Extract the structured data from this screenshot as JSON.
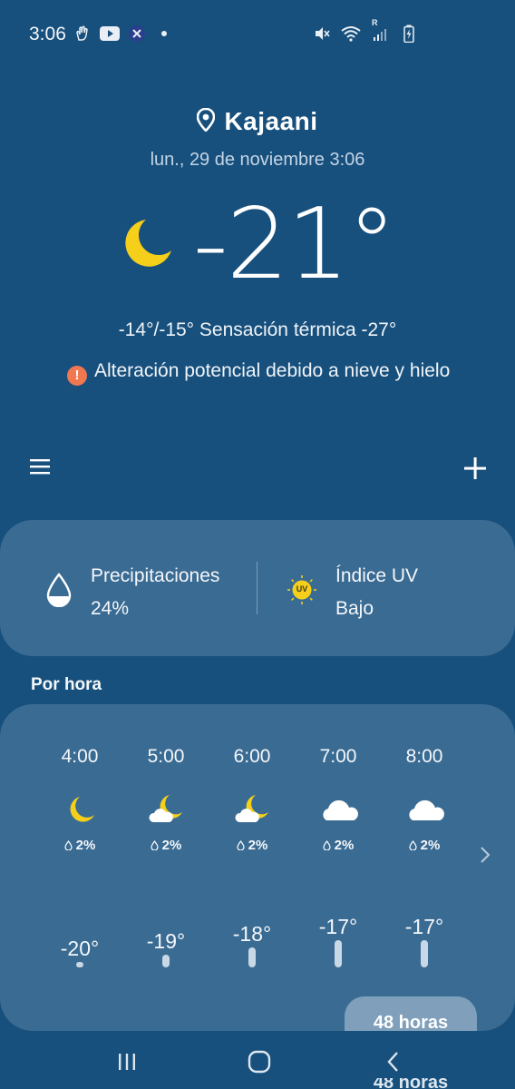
{
  "status_bar": {
    "time": "3:06",
    "left_icons": [
      "gesture-hand-icon",
      "youtube-icon",
      "app-badge-icon",
      "dot-icon"
    ],
    "right_icons": [
      "mute-vibrate-icon",
      "wifi-icon",
      "signal-icon",
      "battery-charging-icon"
    ],
    "signal_label": "R"
  },
  "header": {
    "location": "Kajaani",
    "datetime": "lun., 29 de noviembre 3:06",
    "temperature": "-21°",
    "condition_icon": "moon-icon",
    "feels_like": "-14°/-15° Sensación térmica -27°",
    "alert_icon_glyph": "!",
    "alert_text": "Alteración potencial debido a nieve y hielo"
  },
  "toolbar": {
    "menu_icon": "hamburger-menu-icon",
    "add_icon": "plus-icon"
  },
  "summary": {
    "precip_label": "Precipitaciones",
    "precip_value": "24%",
    "uv_label": "Índice UV",
    "uv_value": "Bajo",
    "uv_badge": "UV"
  },
  "hourly": {
    "title": "Por hora",
    "items": [
      {
        "time": "4:00",
        "icon": "moon-icon",
        "pop": "2%",
        "temp": "-20°",
        "temp_value": -20
      },
      {
        "time": "5:00",
        "icon": "moon-cloud-icon",
        "pop": "2%",
        "temp": "-19°",
        "temp_value": -19
      },
      {
        "time": "6:00",
        "icon": "moon-cloud-icon",
        "pop": "2%",
        "temp": "-18°",
        "temp_value": -18
      },
      {
        "time": "7:00",
        "icon": "cloud-icon",
        "pop": "2%",
        "temp": "-17°",
        "temp_value": -17
      },
      {
        "time": "8:00",
        "icon": "cloud-icon",
        "pop": "2%",
        "temp": "-17°",
        "temp_value": -17
      }
    ],
    "more_button": "48 horas"
  },
  "colors": {
    "background": "#18507d",
    "card": "#3a6b93",
    "moon": "#f5cf1a",
    "alert": "#f07850"
  }
}
